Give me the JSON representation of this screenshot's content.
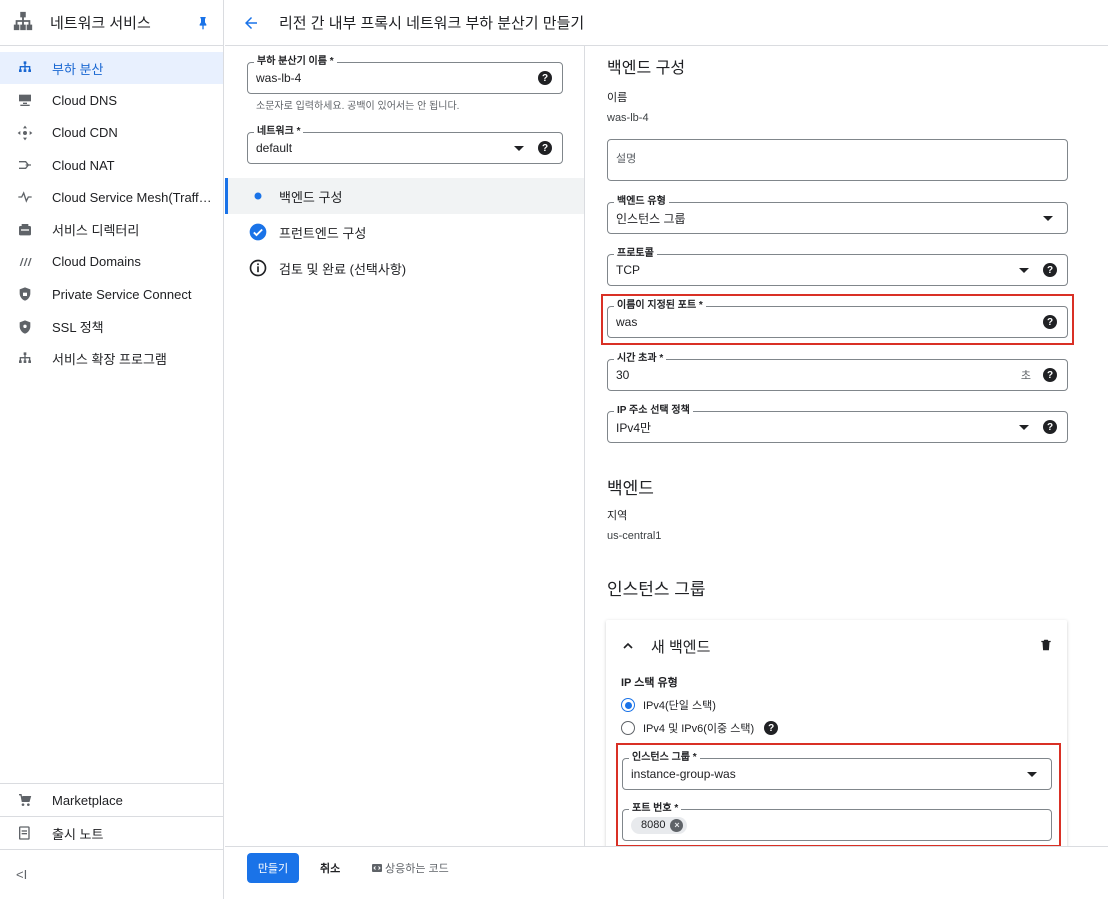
{
  "sidebar": {
    "title": "네트워크 서비스",
    "items": [
      {
        "label": "부하 분산",
        "icon": "load-balancer-icon",
        "active": true
      },
      {
        "label": "Cloud DNS",
        "icon": "dns-icon"
      },
      {
        "label": "Cloud CDN",
        "icon": "cdn-icon"
      },
      {
        "label": "Cloud NAT",
        "icon": "nat-icon"
      },
      {
        "label": "Cloud Service Mesh(Traffi...",
        "icon": "service-mesh-icon"
      },
      {
        "label": "서비스 디렉터리",
        "icon": "service-directory-icon"
      },
      {
        "label": "Cloud Domains",
        "icon": "domains-icon"
      },
      {
        "label": "Private Service Connect",
        "icon": "private-service-connect-icon"
      },
      {
        "label": "SSL 정책",
        "icon": "ssl-policy-icon"
      },
      {
        "label": "서비스 확장 프로그램",
        "icon": "service-extensions-icon"
      }
    ],
    "bottom": [
      {
        "label": "Marketplace",
        "icon": "marketplace-icon"
      },
      {
        "label": "출시 노트",
        "icon": "release-notes-icon"
      }
    ],
    "collapse_label": "<I"
  },
  "header": {
    "title": "리전 간 내부 프록시 네트워크 부하 분산기 만들기"
  },
  "form": {
    "lb_name_label": "부하 분산기 이름 *",
    "lb_name_value": "was-lb-4",
    "lb_name_hint": "소문자로 입력하세요. 공백이 있어서는 안 됩니다.",
    "network_label": "네트워크 *",
    "network_value": "default"
  },
  "steps": [
    {
      "label": "백엔드 구성",
      "state": "current"
    },
    {
      "label": "프런트엔드 구성",
      "state": "done"
    },
    {
      "label": "검토 및 완료 (선택사항)",
      "state": "info"
    }
  ],
  "backend_config": {
    "heading": "백엔드 구성",
    "name_label": "이름",
    "name_value": "was-lb-4",
    "description_placeholder": "설명",
    "backend_type_label": "백엔드 유형",
    "backend_type_value": "인스턴스 그룹",
    "protocol_label": "프로토콜",
    "protocol_value": "TCP",
    "named_port_label": "이름이 지정된 포트 *",
    "named_port_value": "was",
    "timeout_label": "시간 초과 *",
    "timeout_value": "30",
    "timeout_suffix": "초",
    "ip_policy_label": "IP 주소 선택 정책",
    "ip_policy_value": "IPv4만"
  },
  "backends": {
    "heading": "백엔드",
    "region_label": "지역",
    "region_value": "us-central1",
    "instance_group_heading": "인스턴스 그룹"
  },
  "new_backend": {
    "title": "새 백엔드",
    "ip_stack_label": "IP 스택 유형",
    "ip_stack_options": [
      "IPv4(단일 스택)",
      "IPv4 및 IPv6(이중 스택)"
    ],
    "instance_group_label": "인스턴스 그룹 *",
    "instance_group_value": "instance-group-was",
    "port_number_label": "포트 번호 *",
    "port_chip": "8080"
  },
  "footer": {
    "create_label": "만들기",
    "cancel_label": "취소",
    "equivalent_code_label": "상응하는 코드"
  },
  "colors": {
    "accent": "#1a73e8",
    "highlight_box": "#d93025",
    "active_nav_bg": "#e8f0fe"
  }
}
